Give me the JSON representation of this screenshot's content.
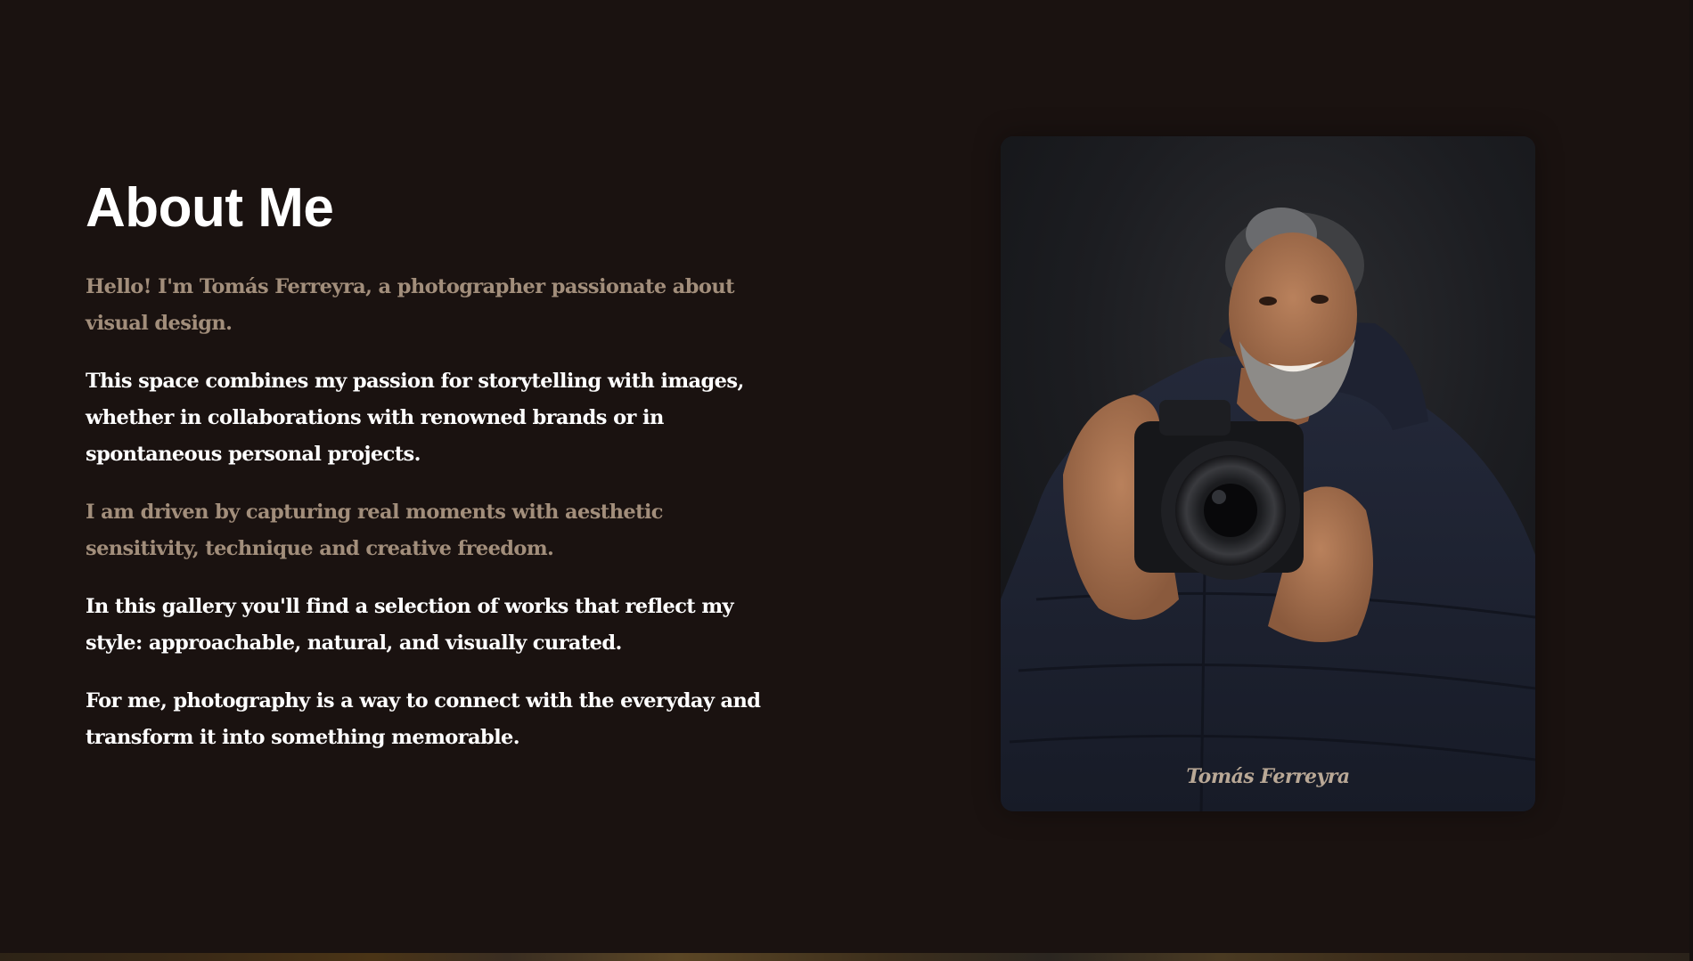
{
  "about": {
    "title": "About Me",
    "paragraphs": [
      "Hello! I'm Tomás Ferreyra, a photographer passionate about visual design.",
      "This space combines my passion for storytelling with images, whether in collaborations with renowned brands or in spontaneous personal projects.",
      "I am driven by capturing real moments with aesthetic sensitivity, technique and creative freedom.",
      "In this gallery you'll find a selection of works that reflect my style: approachable, natural, and visually curated.",
      "For me, photography is a way to connect with the everyday and transform it into something memorable."
    ]
  },
  "portrait": {
    "caption": "Tomás Ferreyra"
  },
  "colors": {
    "background": "#1a1210",
    "muted_text": "#a28e7b",
    "bright_text": "#ffffff",
    "caption": "#b9a896"
  }
}
